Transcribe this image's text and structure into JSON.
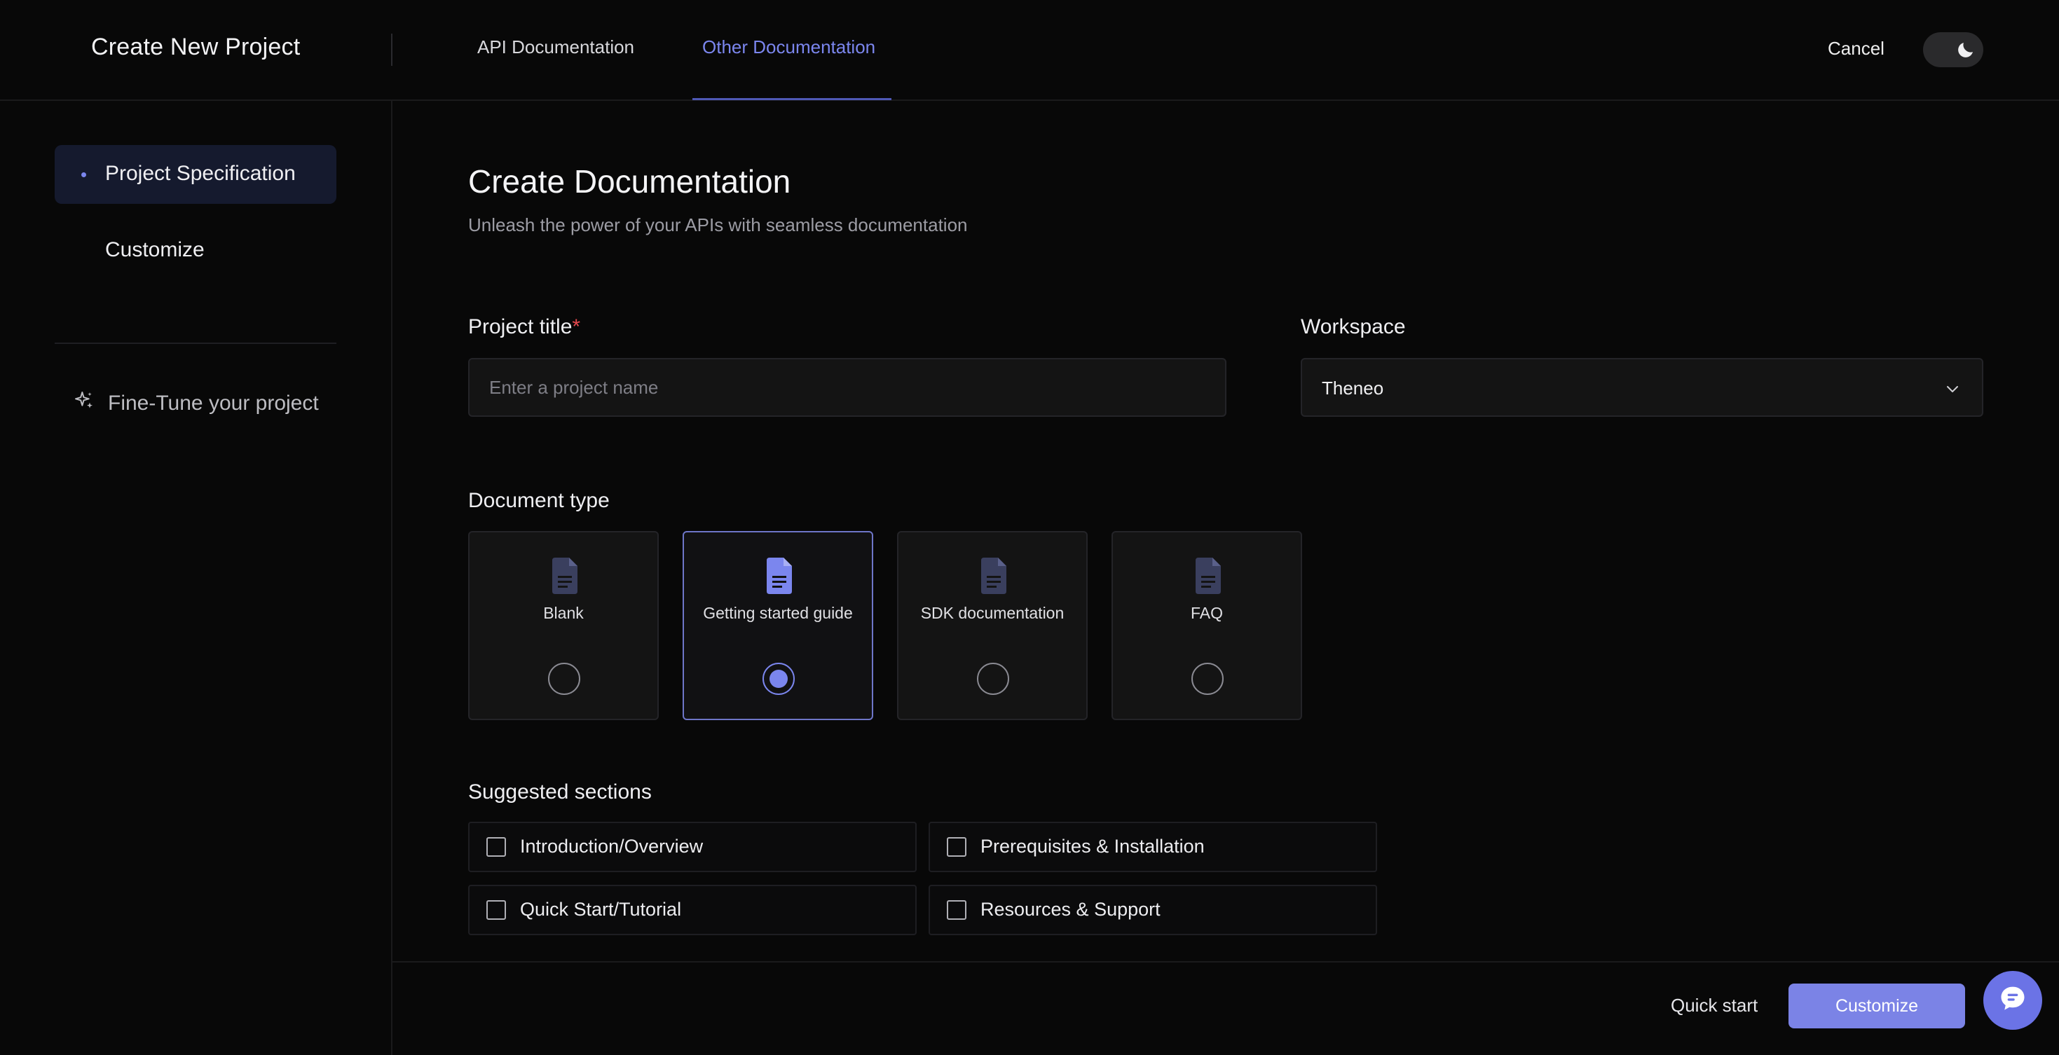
{
  "header": {
    "title": "Create New Project",
    "tabs": [
      {
        "label": "API Documentation",
        "active": false
      },
      {
        "label": "Other Documentation",
        "active": true
      }
    ],
    "cancel_label": "Cancel",
    "theme_toggle_icon": "moon-icon"
  },
  "sidebar": {
    "items": [
      {
        "label": "Project Specification",
        "active": true
      },
      {
        "label": "Customize",
        "active": false
      }
    ],
    "finetune_label": "Fine-Tune your project",
    "finetune_icon": "sparkle-icon"
  },
  "main": {
    "heading": "Create Documentation",
    "subheading": "Unleash the power of your APIs with seamless documentation",
    "project_title": {
      "label": "Project title",
      "required_mark": "*",
      "placeholder": "Enter a project name",
      "value": ""
    },
    "workspace": {
      "label": "Workspace",
      "selected": "Theneo"
    },
    "document_type": {
      "label": "Document type",
      "options": [
        {
          "label": "Blank",
          "selected": false
        },
        {
          "label": "Getting started guide",
          "selected": true
        },
        {
          "label": "SDK documentation",
          "selected": false
        },
        {
          "label": "FAQ",
          "selected": false
        }
      ]
    },
    "suggested_sections": {
      "label": "Suggested sections",
      "items": [
        {
          "label": "Introduction/Overview",
          "checked": false
        },
        {
          "label": "Prerequisites & Installation",
          "checked": false
        },
        {
          "label": "Quick Start/Tutorial",
          "checked": false
        },
        {
          "label": "Resources & Support",
          "checked": false
        }
      ]
    }
  },
  "footer": {
    "quick_start_label": "Quick start",
    "customize_label": "Customize"
  },
  "colors": {
    "accent": "#7b86ee",
    "background": "#080808",
    "required": "#e5484d"
  }
}
